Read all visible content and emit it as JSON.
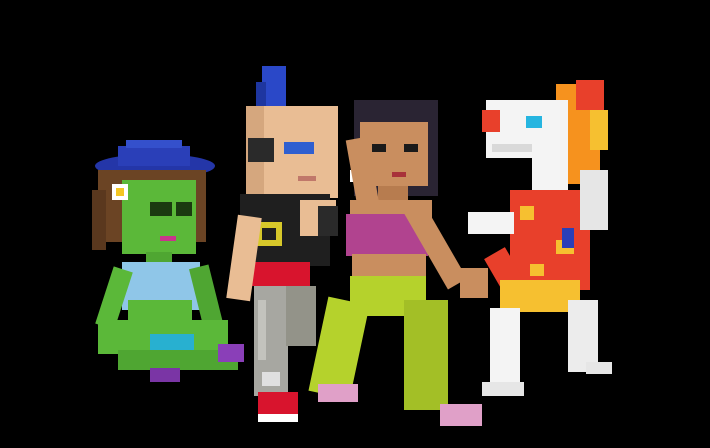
{
  "scene": {
    "background": "#000000",
    "characters": [
      {
        "name": "alien-girl",
        "colors": {
          "skin": "#5bb839",
          "hat": "#2a3fb8",
          "hair": "#6b4424",
          "top": "#8fc6e8",
          "shorts": "#28b0d0",
          "shoes": "#8a3fb8"
        }
      },
      {
        "name": "punk-boy",
        "colors": {
          "skin": "#e9bd94",
          "mohawk": "#2a48c8",
          "shirt": "#1f1f1f",
          "belt": "#d8142d",
          "pants": "#a7a7a1",
          "shoes": "#d8142d"
        }
      },
      {
        "name": "woman",
        "colors": {
          "skin": "#c98e5f",
          "hair": "#2a2433",
          "top": "#b1438f",
          "pants": "#b5d22c",
          "shoes": "#e0a0c8"
        }
      },
      {
        "name": "dragon",
        "colors": {
          "body": "#f4f4f4",
          "mane": "#f6921e",
          "shirt": "#e8402b",
          "eyes": "#26b5e0"
        }
      }
    ]
  }
}
